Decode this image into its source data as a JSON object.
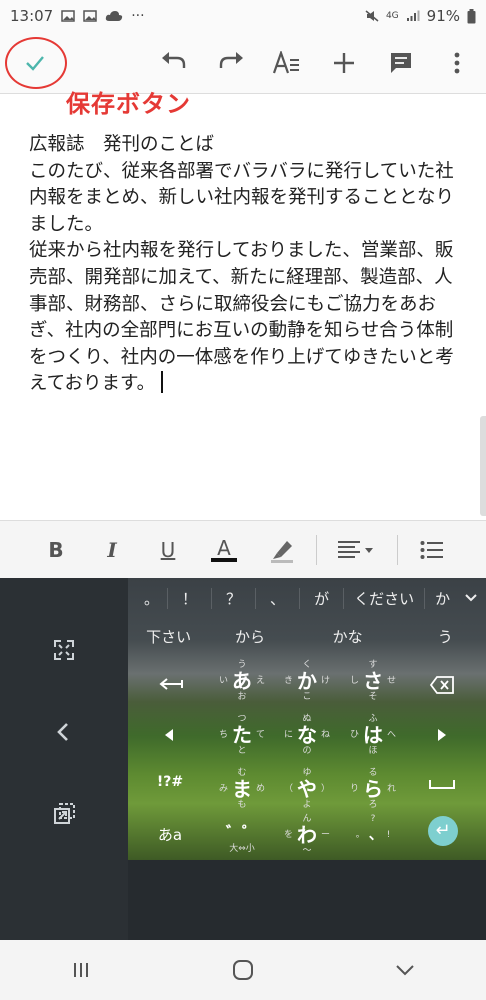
{
  "status_bar": {
    "time": "13:07",
    "battery": "91%",
    "left_icons": [
      "image-icon",
      "image-icon",
      "cloud-icon",
      "more-icon"
    ],
    "right_icons": [
      "mute-icon",
      "4g-icon",
      "signal-icon",
      "battery-icon"
    ]
  },
  "toolbar": {
    "annotation": "保存ボタン",
    "icons": [
      "check-icon",
      "undo-icon",
      "redo-icon",
      "text-format-icon",
      "add-icon",
      "comment-icon",
      "more-vert-icon"
    ]
  },
  "document": {
    "title": "広報誌　発刊のことば",
    "paragraph1": "このたび、従来各部署でバラバラに発行していた社内報をまとめ、新しい社内報を発刊することとなりました。",
    "paragraph2": "従来から社内報を発行しておりました、営業部、販売部、開発部に加えて、新たに経理部、製造部、人事部、財務部、さらに取締役会にもご協力をあおぎ、社内の全部門にお互いの動静を知らせ合う体制をつくり、社内の一体感を作り上げてゆきたいと考えております。"
  },
  "format_bar": {
    "bold": "B",
    "italic": "I",
    "underline": "U",
    "text_color": "A",
    "colors": {
      "text_color_bar": "#111111",
      "accent": "#4db6ac"
    }
  },
  "keyboard": {
    "candidates": [
      "。",
      "！",
      "？",
      "、",
      "が",
      "ください",
      "か"
    ],
    "suggestions": [
      "下さい",
      "から",
      "かな",
      "う"
    ],
    "keys": [
      {
        "main": "あ",
        "left": "い",
        "up": "う",
        "right": "え",
        "down": "お"
      },
      {
        "main": "か",
        "left": "き",
        "up": "く",
        "right": "け",
        "down": "こ"
      },
      {
        "main": "さ",
        "left": "し",
        "up": "す",
        "right": "せ",
        "down": "そ"
      },
      {
        "main": "た",
        "left": "ち",
        "up": "つ",
        "right": "て",
        "down": "と"
      },
      {
        "main": "な",
        "left": "に",
        "up": "ぬ",
        "right": "ね",
        "down": "の"
      },
      {
        "main": "は",
        "left": "ひ",
        "up": "ふ",
        "right": "へ",
        "down": "ほ"
      },
      {
        "main": "ま",
        "left": "み",
        "up": "む",
        "right": "め",
        "down": "も"
      },
      {
        "main": "や",
        "left": "（",
        "up": "ゆ",
        "right": "）",
        "down": "よ"
      },
      {
        "main": "ら",
        "left": "り",
        "up": "る",
        "right": "れ",
        "down": "ろ"
      },
      {
        "main": "わ",
        "left": "を",
        "up": "ん",
        "right": "ー",
        "down": "〜"
      }
    ],
    "dakuten": "゛゜",
    "dakuten_sub": "大⇔小",
    "symbols": "!?#",
    "mode": "あa",
    "punct": {
      "up": "?",
      "left": "。",
      "center": "、",
      "right": "!"
    }
  }
}
